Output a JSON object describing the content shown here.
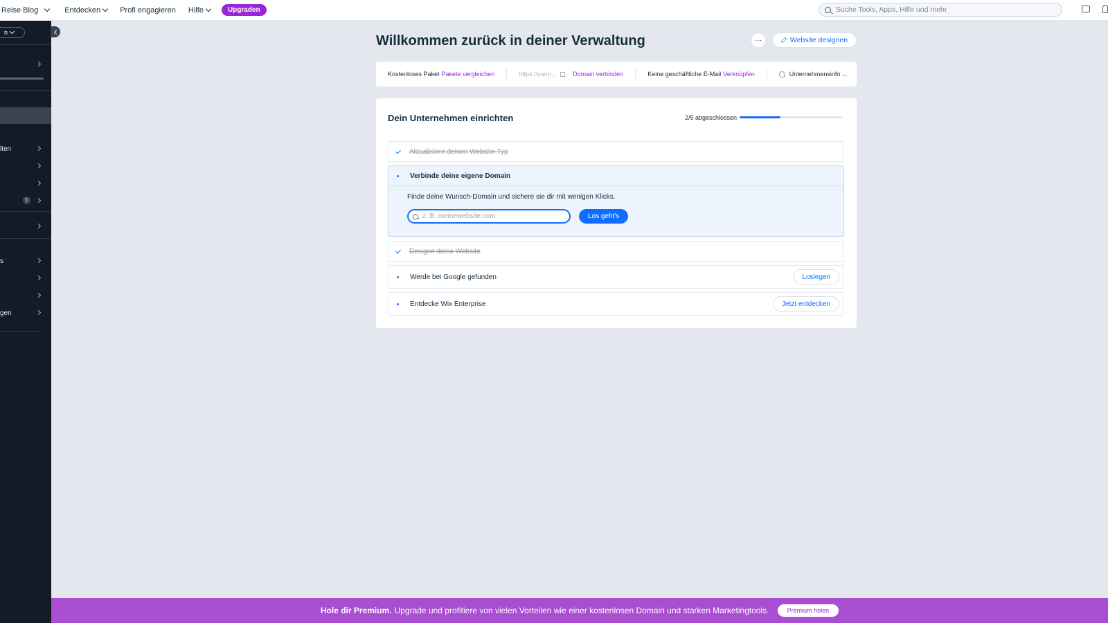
{
  "topbar": {
    "site_name": "Reise Blog",
    "nav": [
      {
        "label": "Entdecken"
      },
      {
        "label": "Profi engagieren"
      },
      {
        "label": "Hilfe"
      }
    ],
    "upgrade_label": "Upgraden",
    "search_placeholder": "Suche Tools, Apps, Hilfe und mehr"
  },
  "sidebar": {
    "pill_label": "n",
    "items": [
      {
        "label": "lten"
      },
      {
        "label": ""
      },
      {
        "label": ""
      },
      {
        "label": "",
        "badge": "1"
      },
      {
        "label": ""
      },
      {
        "label": "s"
      },
      {
        "label": ""
      },
      {
        "label": ""
      },
      {
        "label": "gen"
      }
    ]
  },
  "header": {
    "title": "Willkommen zurück in deiner Verwaltung",
    "more_label": "···",
    "design_label": "Website designen"
  },
  "info_bar": {
    "plan_text": "Kostenloses Paket",
    "plan_link": "Pakete vergleichen",
    "url_text": "https://yann...",
    "domain_link": "Domain verbinden",
    "email_text": "Keine geschäftliche E-Mail",
    "email_link": "Verknüpfen",
    "company_text": "Unternehmensinfo ..."
  },
  "setup": {
    "title": "Dein Unternehmen einrichten",
    "progress_label": "2/5 abgeschlossen",
    "progress_fraction": 0.4,
    "tasks": [
      {
        "label": "Aktualisiere deinen Website-Typ",
        "done": true
      },
      {
        "label": "Verbinde deine eigene Domain",
        "done": false,
        "open": true,
        "description": "Finde deine Wunsch-Domain und sichere sie dir mit wenigen Klicks.",
        "input_placeholder": "z. B. meinewebsite.com",
        "button": "Los geht's"
      },
      {
        "label": "Designe deine Website",
        "done": true
      },
      {
        "label": "Werde bei Google gefunden",
        "done": false,
        "button": "Loslegen"
      },
      {
        "label": "Entdecke Wix Enterprise",
        "done": false,
        "button": "Jetzt entdecken"
      }
    ]
  },
  "banner": {
    "bold": "Hole dir Premium.",
    "text": "Upgrade und profitiere von vielen Vorteilen wie einer kostenlosen Domain und starken Marketingtools.",
    "button": "Premium holen"
  },
  "colors": {
    "accent": "#116dff",
    "brand_purple": "#9a27d5",
    "banner": "#a94dd1",
    "sidebar": "#131b26"
  }
}
